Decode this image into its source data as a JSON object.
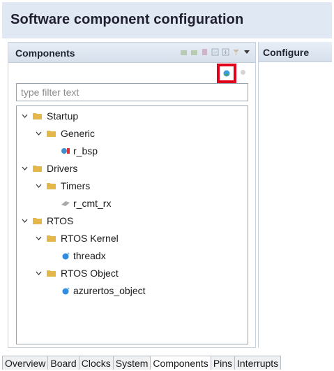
{
  "window": {
    "title": "Software component configuration"
  },
  "components_panel": {
    "header": "Components",
    "filter": {
      "placeholder": "type filter text",
      "value": ""
    }
  },
  "configure_panel": {
    "header": "Configure"
  },
  "tree": {
    "startup": "Startup",
    "generic": "Generic",
    "r_bsp": "r_bsp",
    "drivers": "Drivers",
    "timers": "Timers",
    "r_cmt_rx": "r_cmt_rx",
    "rtos": "RTOS",
    "rtos_kernel": "RTOS Kernel",
    "threadx": "threadx",
    "rtos_object": "RTOS Object",
    "azurertos_object": "azurertos_object"
  },
  "tabs": [
    "Overview",
    "Board",
    "Clocks",
    "System",
    "Components",
    "Pins",
    "Interrupts"
  ],
  "active_tab": "Components",
  "colors": {
    "highlight_box": "#e0001b",
    "folder": "#e3b74a",
    "title_bg": "#dfe8f3"
  }
}
